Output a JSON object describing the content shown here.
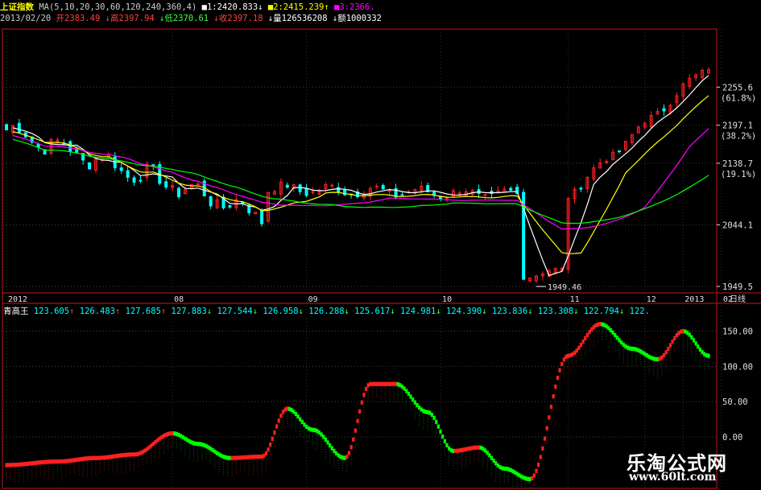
{
  "header": {
    "title": "上证指数",
    "ma_params": "MA(5,10,20,30,60,120,240,360,4)",
    "ma1": "■1:2420.833↓",
    "ma2": "■2:2415.239↑",
    "ma3": "■3:2366.",
    "date": "2013/02/20",
    "open": "开2383.49",
    "high": "↓高2397.94",
    "low": "↓低2370.61",
    "close": "↓收2397.18",
    "volume": "↓量126536208",
    "amount": "↓额1000332"
  },
  "indicator": {
    "name": "青高王",
    "values": [
      "123.605",
      "126.483",
      "127.685",
      "127.883",
      "127.544",
      "126.958",
      "126.288",
      "125.617",
      "124.981",
      "124.390",
      "123.836",
      "123.308",
      "122.794",
      "122."
    ],
    "arrows": [
      "↑",
      "↑",
      "↑",
      "↓",
      "↓",
      "↓",
      "↓",
      "↓",
      "↓",
      "↓",
      "↓",
      "↓",
      "↓",
      ""
    ]
  },
  "watermark": {
    "text": "乐淘公式网",
    "url": "www.60lt.com"
  },
  "colors": {
    "up": "#ff2020",
    "down": "#00ffff",
    "ind_up": "#ff2020",
    "ind_down": "#00ff00",
    "frame": "#a0101a",
    "grid": "#404040",
    "ma1": "#ffffff",
    "ma2": "#ffff00",
    "ma3": "#ff00ff",
    "ma4": "#00ff00"
  },
  "chart_data": [
    {
      "type": "candlestick",
      "title": "上证指数",
      "period": "日线",
      "x_month_labels": [
        "2012",
        "08",
        "09",
        "10",
        "11",
        "12",
        "2013",
        "02"
      ],
      "y_ticks": [
        "2255.6",
        "2197.1",
        "2138.7",
        "2044.1",
        "1949.5"
      ],
      "y_pct": [
        "(61.8%)",
        "(38.2%)",
        "(19.1%)"
      ],
      "ylim": [
        1949.5,
        2340
      ],
      "low_annotation": "1949.46",
      "segments": [
        {
          "from": 0,
          "to": 40,
          "open": 2190,
          "close": 2060,
          "wave": 22
        },
        {
          "from": 41,
          "to": 80,
          "open": 2100,
          "close": 2090,
          "wave": 12
        },
        {
          "from": 81,
          "to": 87,
          "open": 1965,
          "close": 1975,
          "wave": 6
        },
        {
          "from": 88,
          "to": 110,
          "open": 2090,
          "close": 2290,
          "wave": 10
        }
      ],
      "ma_lines": [
        "ma1",
        "ma2",
        "ma3",
        "ma4"
      ]
    },
    {
      "type": "line",
      "title": "青高王",
      "y_ticks": [
        "150.00",
        "100.00",
        "50.00",
        "0.00"
      ],
      "ylim": [
        -40,
        170
      ],
      "knots": [
        [
          0,
          -40
        ],
        [
          8,
          -35
        ],
        [
          14,
          -30
        ],
        [
          20,
          -25
        ],
        [
          26,
          5
        ],
        [
          30,
          -10
        ],
        [
          35,
          -30
        ],
        [
          40,
          -28
        ],
        [
          44,
          40
        ],
        [
          48,
          10
        ],
        [
          53,
          -30
        ],
        [
          57,
          75
        ],
        [
          61,
          75
        ],
        [
          66,
          35
        ],
        [
          70,
          -20
        ],
        [
          74,
          -15
        ],
        [
          78,
          -45
        ],
        [
          82,
          -60
        ],
        [
          88,
          115
        ],
        [
          93,
          160
        ],
        [
          98,
          125
        ],
        [
          102,
          110
        ],
        [
          106,
          150
        ],
        [
          110,
          115
        ]
      ]
    }
  ]
}
